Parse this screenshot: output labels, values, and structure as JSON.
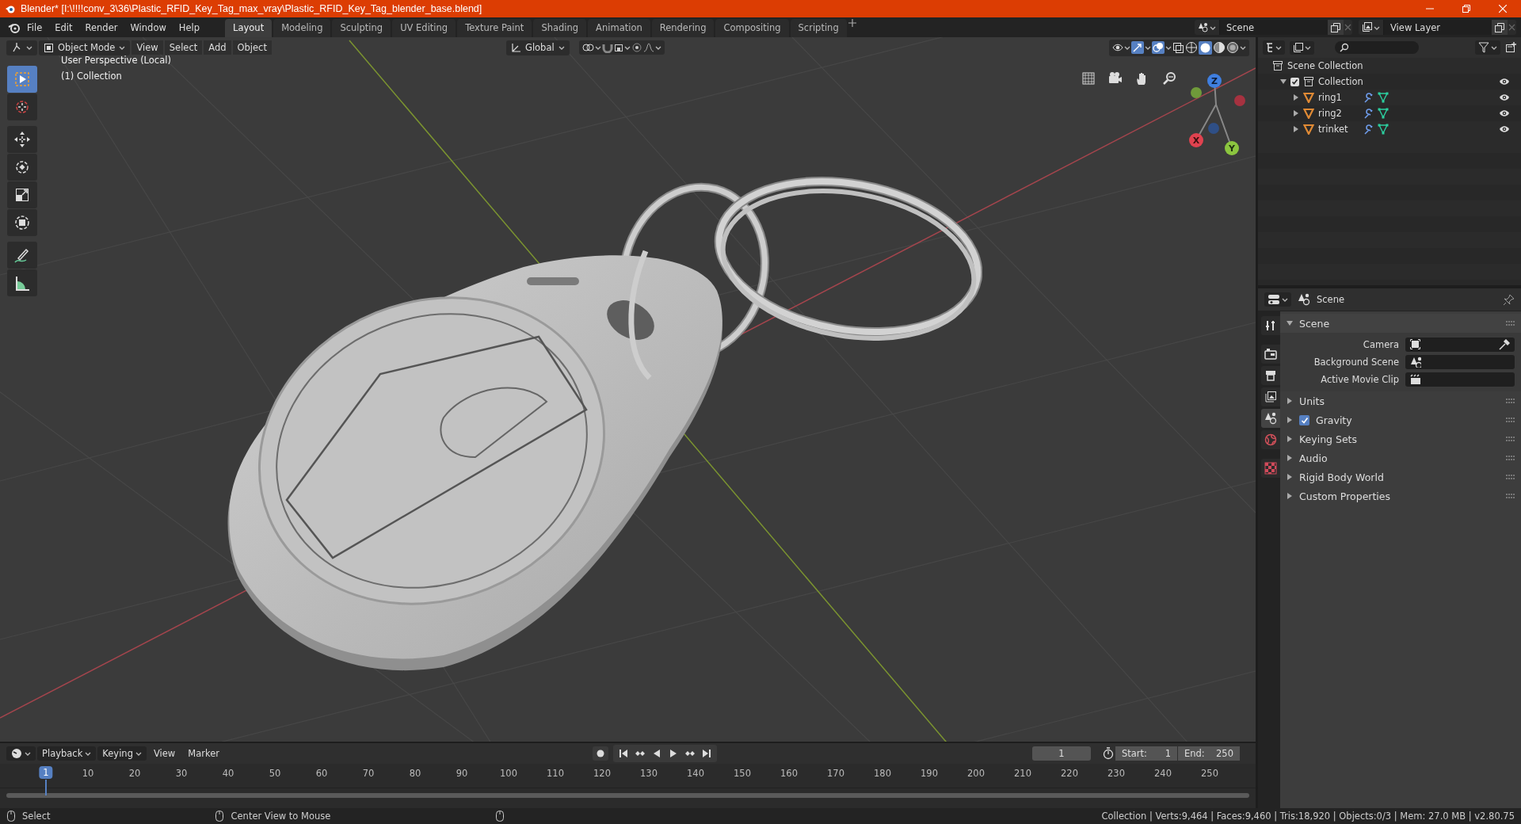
{
  "window": {
    "title": "Blender* [I:\\!!!!conv_3\\36\\Plastic_RFID_Key_Tag_max_vray\\Plastic_RFID_Key_Tag_blender_base.blend]"
  },
  "menu": [
    "File",
    "Edit",
    "Render",
    "Window",
    "Help"
  ],
  "workspaces": [
    {
      "label": "Layout",
      "selected": true
    },
    {
      "label": "Modeling",
      "selected": false
    },
    {
      "label": "Sculpting",
      "selected": false
    },
    {
      "label": "UV Editing",
      "selected": false
    },
    {
      "label": "Texture Paint",
      "selected": false
    },
    {
      "label": "Shading",
      "selected": false
    },
    {
      "label": "Animation",
      "selected": false
    },
    {
      "label": "Rendering",
      "selected": false
    },
    {
      "label": "Compositing",
      "selected": false
    },
    {
      "label": "Scripting",
      "selected": false
    }
  ],
  "scene_selector": {
    "value": "Scene"
  },
  "view_layer_selector": {
    "value": "View Layer"
  },
  "viewport": {
    "header": {
      "mode": "Object Mode",
      "menus": [
        "View",
        "Select",
        "Add",
        "Object"
      ],
      "orientation": "Global"
    },
    "tools": [
      {
        "kind": "select",
        "selected": true
      },
      {
        "kind": "cursor",
        "selected": false
      },
      {
        "kind": "move",
        "selected": false
      },
      {
        "kind": "rotate",
        "selected": false
      },
      {
        "kind": "scale",
        "selected": false
      },
      {
        "kind": "transform",
        "selected": false
      },
      {
        "kind": "annotate",
        "selected": false
      },
      {
        "kind": "measure",
        "selected": false
      }
    ],
    "overlay_text": [
      "User Perspective (Local)",
      "(1) Collection"
    ],
    "gizmo_labels": [
      "X",
      "Y",
      "Z"
    ]
  },
  "outliner": {
    "root": "Scene Collection",
    "items": [
      {
        "label": "Collection",
        "checked": true,
        "expanded": true,
        "children": [
          {
            "label": "ring1",
            "expanded": false
          },
          {
            "label": "ring2",
            "expanded": false
          },
          {
            "label": "trinket",
            "expanded": false
          }
        ]
      }
    ]
  },
  "properties": {
    "context": "Scene",
    "tabs": [
      {
        "kind": "tool",
        "selected": false
      },
      {
        "kind": "render",
        "selected": false
      },
      {
        "kind": "output",
        "selected": false
      },
      {
        "kind": "view_layer",
        "selected": false
      },
      {
        "kind": "scene",
        "selected": true
      },
      {
        "kind": "world",
        "selected": false
      },
      {
        "kind": "texture",
        "selected": false
      }
    ],
    "panels": [
      {
        "label": "Scene",
        "expanded": true,
        "fields": [
          {
            "label": "Camera",
            "kind": "camera"
          },
          {
            "label": "Background Scene",
            "kind": "scene"
          },
          {
            "label": "Active Movie Clip",
            "kind": "clip"
          }
        ]
      },
      {
        "label": "Units",
        "expanded": false
      },
      {
        "label": "Gravity",
        "expanded": false,
        "checked": true
      },
      {
        "label": "Keying Sets",
        "expanded": false
      },
      {
        "label": "Audio",
        "expanded": false
      },
      {
        "label": "Rigid Body World",
        "expanded": false
      },
      {
        "label": "Custom Properties",
        "expanded": false
      }
    ]
  },
  "timeline": {
    "menus": [
      "Playback",
      "Keying",
      "View",
      "Marker"
    ],
    "current_frame": "1",
    "start_label": "Start:",
    "start": "1",
    "end_label": "End:",
    "end": "250",
    "playhead": "1",
    "ticks": [
      "10",
      "20",
      "30",
      "40",
      "50",
      "60",
      "70",
      "80",
      "90",
      "100",
      "110",
      "120",
      "130",
      "140",
      "150",
      "160",
      "170",
      "180",
      "190",
      "200",
      "210",
      "220",
      "230",
      "240",
      "250"
    ]
  },
  "status_bar": {
    "hints": [
      "Select",
      "Center View to Mouse"
    ],
    "stats": "Collection | Verts:9,464 | Faces:9,460 | Tris:18,920 | Objects:0/3 | Mem: 27.0 MB | v2.80.75"
  }
}
